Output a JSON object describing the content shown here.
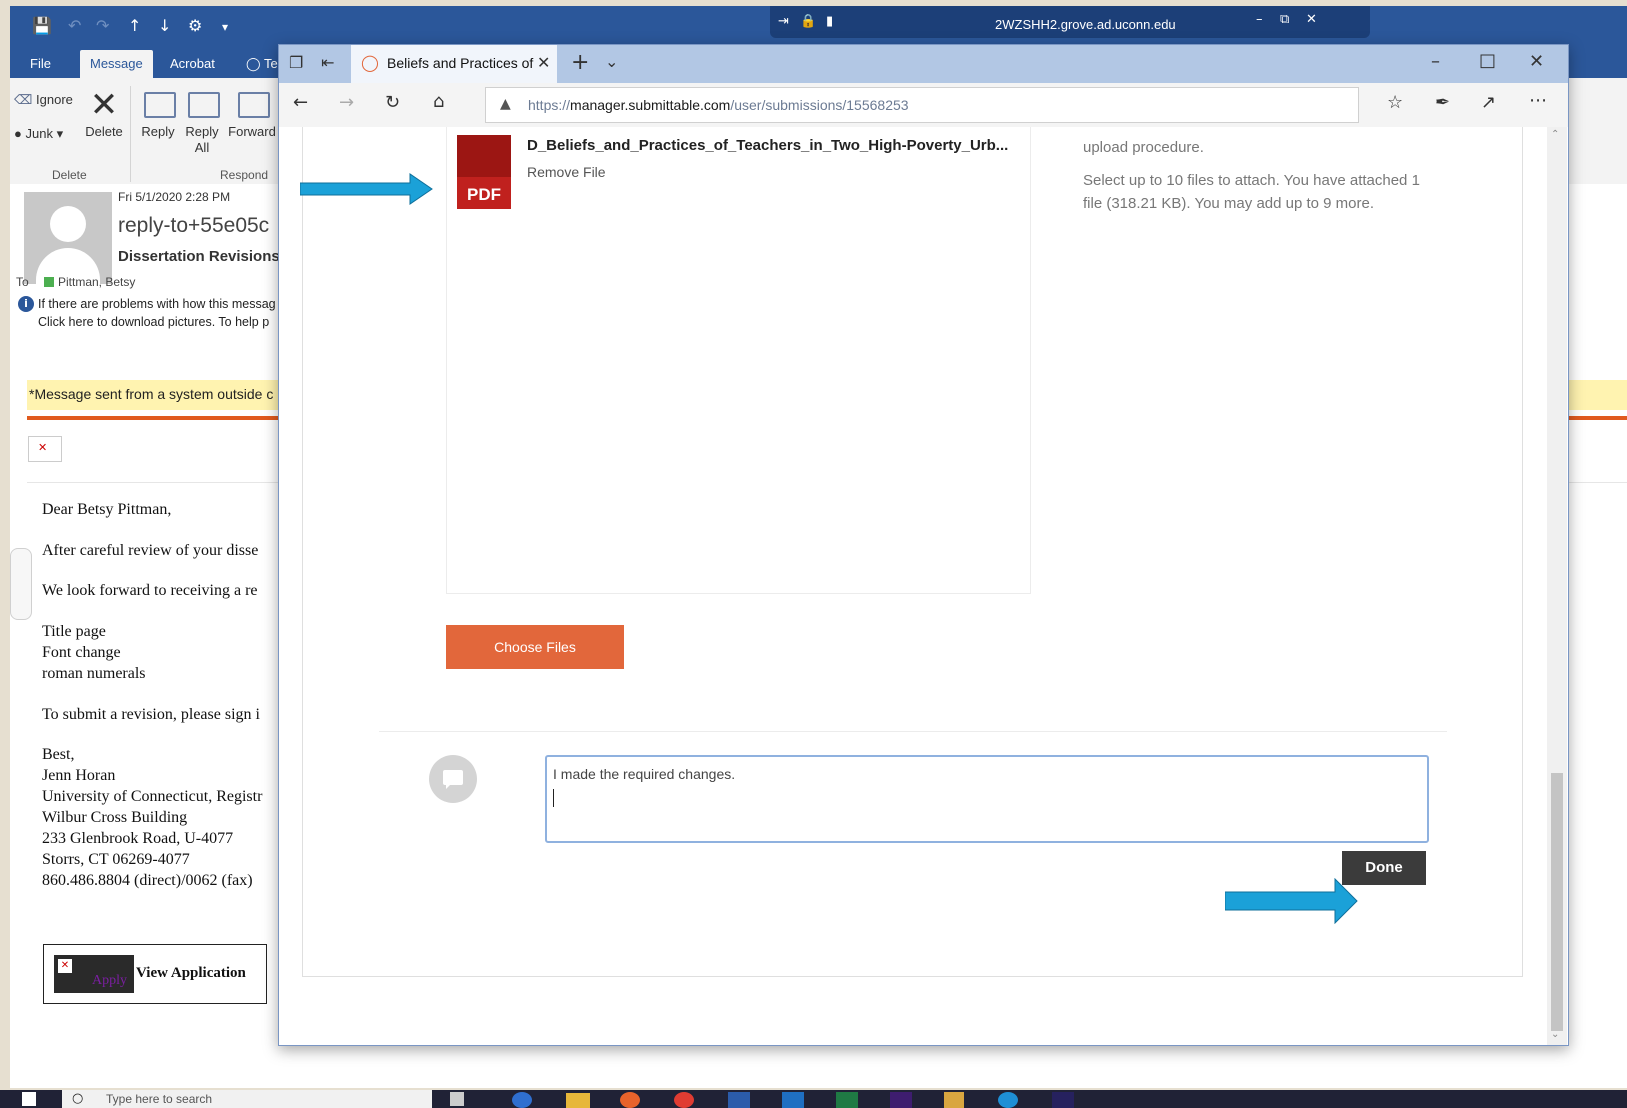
{
  "remote": {
    "host": "2WZSHH2.grove.ad.uconn.edu"
  },
  "outlook": {
    "tabs": [
      "File",
      "Message",
      "Acrobat",
      "Te"
    ],
    "ribbon": {
      "ignore": "Ignore",
      "junk": "Junk",
      "delete": "Delete",
      "reply": "Reply",
      "reply_all_1": "Reply",
      "reply_all_2": "All",
      "forward": "Forward",
      "group_delete": "Delete",
      "group_respond": "Respond"
    },
    "message": {
      "date": "Fri 5/1/2020 2:28 PM",
      "from": "reply-to+55e05c",
      "subject": "Dissertation Revisions",
      "to_label": "To",
      "to_name": "Pittman, Betsy",
      "info_1": "If there are problems with how this messag",
      "info_2": "Click here to download pictures. To help p",
      "banner": "*Message sent from a system outside c",
      "body": [
        "Dear Betsy Pittman,",
        "After careful review of your disse",
        "We look forward to receiving a re",
        "Title page",
        "Font change",
        "roman numerals",
        "To submit a revision, please sign i",
        "Best,",
        "Jenn Horan",
        "University of Connecticut, Registr",
        "Wilbur Cross Building",
        "233 Glenbrook Road, U-4077",
        "Storrs, CT 06269-4077",
        "860.486.8804 (direct)/0062 (fax)"
      ],
      "view_app_prefix": "Apply",
      "view_app": "View Application"
    }
  },
  "browser": {
    "tab_title": "Beliefs and Practices of",
    "url_prefix": "https://",
    "url_host": "manager.submittable.com",
    "url_path": "/user/submissions/15568253"
  },
  "page": {
    "file_name": "D_Beliefs_and_Practices_of_Teachers_in_Two_High-Poverty_Urb...",
    "pdf_label": "PDF",
    "remove_file": "Remove File",
    "help_top": "upload procedure.",
    "help_body": "Select up to 10 files to attach. You have attached 1 file (318.21 KB). You may add up to 9 more.",
    "choose_files": "Choose Files",
    "comment": "I made the required changes.",
    "done": "Done"
  },
  "taskbar": {
    "search_placeholder": "Type here to search"
  },
  "colors": {
    "accent": "#2b579a",
    "orange": "#e2673b",
    "arrow": "#1ba1d8",
    "done": "#3b3b3b"
  }
}
